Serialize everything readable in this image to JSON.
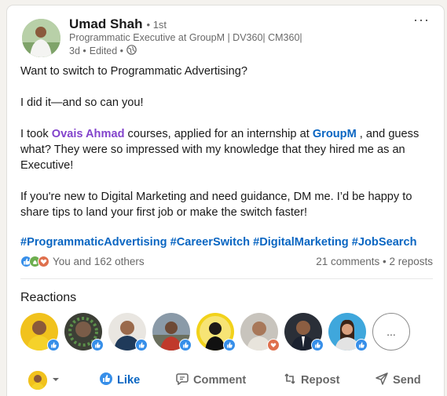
{
  "post": {
    "author": {
      "name": "Umad Shah",
      "degree": "• 1st",
      "headline": "Programmatic Executive at GroupM | DV360| CM360|",
      "time": "3d •",
      "edited": "Edited •",
      "visibility_icon": "globe-icon"
    },
    "more_label": "···",
    "body": {
      "p1": "Want to switch to Programmatic Advertising?",
      "p2": "I did it—and so can you!",
      "p3_prefix": "I took ",
      "p3_mention": "Ovais Ahmad",
      "p3_mid": " courses, applied for an internship at ",
      "p3_company": "GroupM",
      "p3_suffix": " , and guess what? They were so impressed with my knowledge that they hired me as an Executive!",
      "p4": "If you're new to Digital Marketing and need guidance, DM me. I’d be happy to share tips to land your first job or make the switch faster!"
    },
    "hashtags": [
      "#ProgrammaticAdvertising",
      "#CareerSwitch",
      "#DigitalMarketing",
      "#JobSearch"
    ],
    "social": {
      "reactions_text": "You and 162 others",
      "comments": "21 comments",
      "separator": " • ",
      "reposts": "2 reposts"
    },
    "reactions_section": {
      "title": "Reactions",
      "more_label": "..."
    },
    "actions": {
      "like": "Like",
      "comment": "Comment",
      "repost": "Repost",
      "send": "Send"
    }
  },
  "colors": {
    "brand": "#0a66c2",
    "mention": "#8344cc",
    "like_badge": "#378fe9",
    "love_badge": "#df704d",
    "celebrate_badge": "#6dae4f"
  }
}
